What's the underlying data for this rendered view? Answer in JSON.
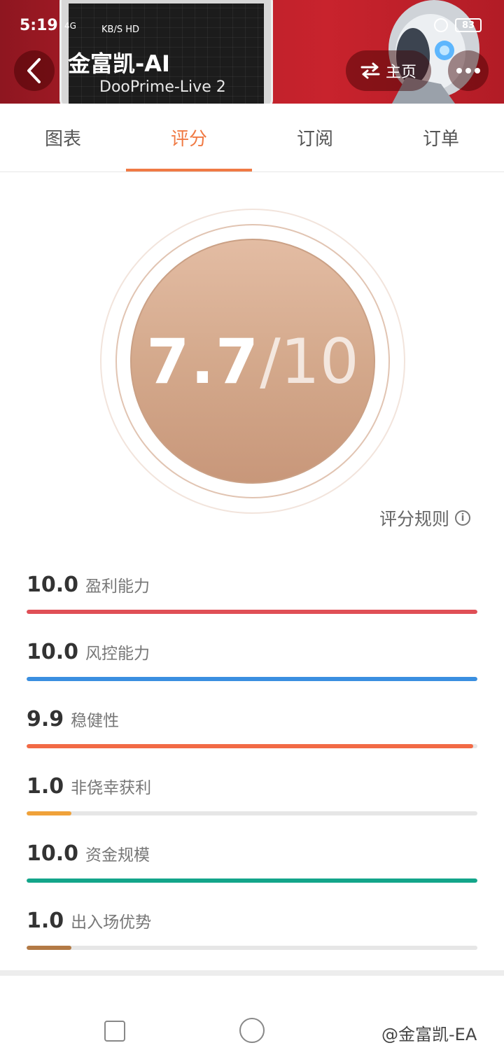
{
  "status_bar": {
    "time": "5:19",
    "network": "4G",
    "speed": "KB/S HD",
    "battery": "83"
  },
  "header": {
    "back_icon": "chevron-left-icon",
    "title": "金富凯-AI",
    "subtitle": "DooPrime-Live 2",
    "home_label": "主页",
    "home_icon": "swap-icon",
    "more_icon": "more-dots-icon"
  },
  "tabs": [
    {
      "label": "图表",
      "active": false
    },
    {
      "label": "评分",
      "active": true
    },
    {
      "label": "订阅",
      "active": false
    },
    {
      "label": "订单",
      "active": false
    }
  ],
  "score": {
    "value": "7.7",
    "slash": "/",
    "total": "10"
  },
  "rules": {
    "label": "评分规则",
    "icon": "info-icon"
  },
  "metrics": [
    {
      "value": "10.0",
      "label": "盈利能力",
      "fill": 1.0,
      "color": "#e04f56"
    },
    {
      "value": "10.0",
      "label": "风控能力",
      "fill": 1.0,
      "color": "#3a8fe0"
    },
    {
      "value": "9.9",
      "label": "稳健性",
      "fill": 0.99,
      "color": "#f26a45"
    },
    {
      "value": "1.0",
      "label": "非侥幸获利",
      "fill": 0.1,
      "color": "#f0a23a"
    },
    {
      "value": "10.0",
      "label": "资金规模",
      "fill": 1.0,
      "color": "#13a58a"
    },
    {
      "value": "1.0",
      "label": "出入场优势",
      "fill": 0.1,
      "color": "#b37a45"
    }
  ],
  "watermark": "@金富凯-EA",
  "colors": {
    "accent": "#f07a44",
    "banner": "#c8232d",
    "disc": "#d4a98c"
  }
}
